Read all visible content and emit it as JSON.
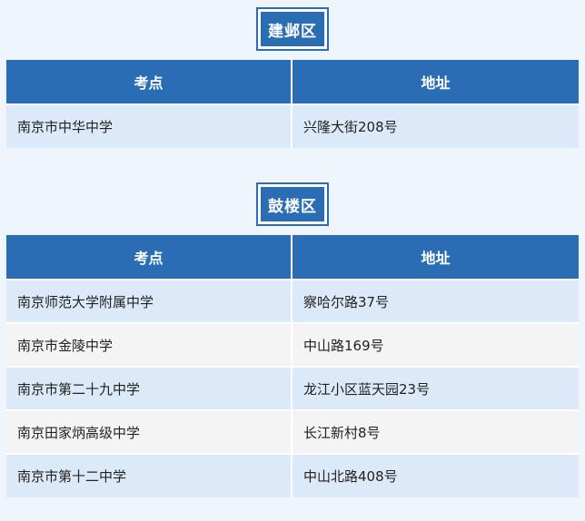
{
  "sections": [
    {
      "district": "建邺区",
      "headers": [
        "考点",
        "地址"
      ],
      "rows": [
        [
          "南京市中华中学",
          "兴隆大街208号"
        ]
      ]
    },
    {
      "district": "鼓楼区",
      "headers": [
        "考点",
        "地址"
      ],
      "rows": [
        [
          "南京师范大学附属中学",
          "察哈尔路37号"
        ],
        [
          "南京市金陵中学",
          "中山路169号"
        ],
        [
          "南京市第二十九中学",
          "龙江小区蓝天园23号"
        ],
        [
          "南京田家炳高级中学",
          "长江新村8号"
        ],
        [
          "南京市第十二中学",
          "中山北路408号"
        ]
      ]
    }
  ]
}
